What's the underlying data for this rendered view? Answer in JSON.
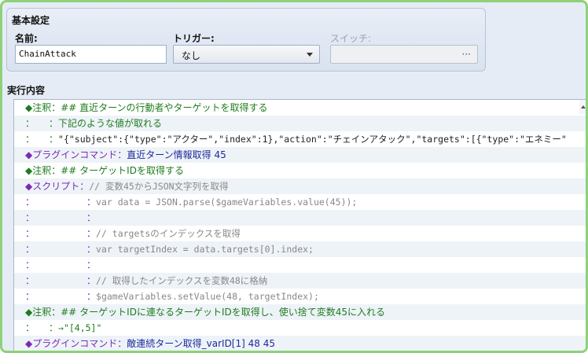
{
  "basic": {
    "title": "基本設定",
    "name_label": "名前:",
    "name_value": "ChainAttack",
    "trigger_label": "トリガー:",
    "trigger_value": "なし",
    "switch_label": "スイッチ:",
    "switch_button": "···"
  },
  "contents": {
    "title": "実行内容",
    "rows": [
      {
        "p1": "◆注釈：",
        "p2": "## 直近ターンの行動者やターゲットを取得する"
      },
      {
        "p1": "：　　：",
        "p2": "下記のような値が取れる"
      },
      {
        "p1": "：　　：",
        "p2": "\"{\"subject\":{\"type\":\"アクター\",\"index\":1},\"action\":\"チェインアタック\",\"targets\":[{\"type\":\"エネミー\""
      },
      {
        "p1": "◆プラグインコマンド：",
        "p2": "直近ターン情報取得 45"
      },
      {
        "p1": "◆注釈：",
        "p2": "## ターゲットIDを取得する"
      },
      {
        "p1": "◆スクリプト：",
        "p2": "// 変数45からJSON文字列を取得"
      },
      {
        "p1": "：　　　　　　：",
        "p2": "var data = JSON.parse($gameVariables.value(45));"
      },
      {
        "p1": "：　　　　　　：",
        "p2": ""
      },
      {
        "p1": "：　　　　　　：",
        "p2": "// targetsのインデックスを取得"
      },
      {
        "p1": "：　　　　　　：",
        "p2": "var targetIndex = data.targets[0].index;"
      },
      {
        "p1": "：　　　　　　：",
        "p2": ""
      },
      {
        "p1": "：　　　　　　：",
        "p2": "// 取得したインデックスを変数48に格納"
      },
      {
        "p1": "：　　　　　　：",
        "p2": "$gameVariables.setValue(48, targetIndex);"
      },
      {
        "p1": "◆注釈：",
        "p2": "## ターゲットIDに連なるターゲットIDを取得し、使い捨て変数45に入れる"
      },
      {
        "p1": "：　　：",
        "p2": "→\"[4,5]\""
      },
      {
        "p1": "◆プラグインコマンド：",
        "p2": "敵連続ターン取得_varID[1] 48 45"
      }
    ]
  },
  "colors": {
    "frame": "#8fd17a",
    "comment": "#1f7c1f",
    "plugin": "#7b2bb4",
    "script": "#7b2bb4",
    "script_body": "#888888"
  }
}
